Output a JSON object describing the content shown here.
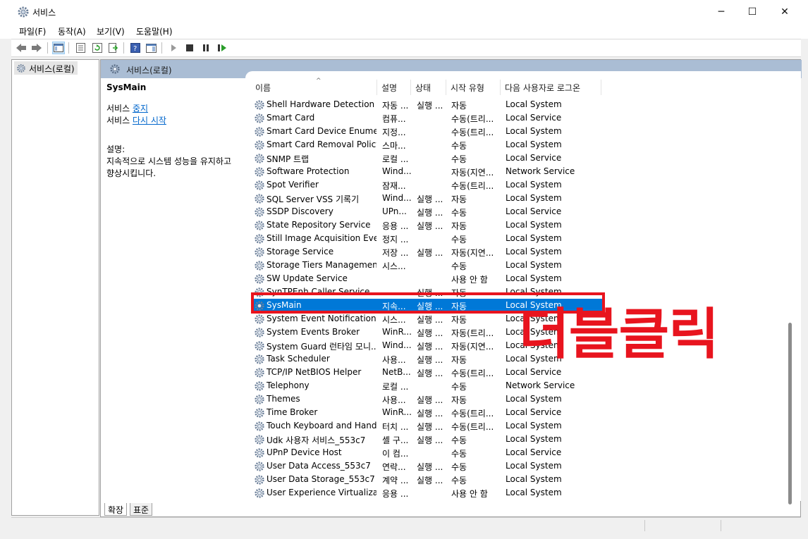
{
  "window": {
    "title": "서비스",
    "min": "─",
    "max": "☐",
    "close": "✕"
  },
  "menu": [
    "파일(F)",
    "동작(A)",
    "보기(V)",
    "도움말(H)"
  ],
  "tree": {
    "root": "서비스(로컬)"
  },
  "panel": {
    "title": "서비스(로컬)"
  },
  "description": {
    "service_name": "SysMain",
    "stop_prefix": "서비스 ",
    "stop_link": "중지",
    "restart_prefix": "서비스 ",
    "restart_link": "다시 시작",
    "desc_label": "설명:",
    "desc_text_1": "지속적으로 시스템 성능을 유지하고",
    "desc_text_2": "향상시킵니다."
  },
  "columns": [
    "이름",
    "설명",
    "상태",
    "시작 유형",
    "다음 사용자로 로그온"
  ],
  "services": [
    {
      "name": "Shell Hardware Detection",
      "desc": "자동 ...",
      "status": "실행 ...",
      "startup": "자동",
      "logon": "Local System"
    },
    {
      "name": "Smart Card",
      "desc": "컴퓨...",
      "status": "",
      "startup": "수동(트리...",
      "logon": "Local Service"
    },
    {
      "name": "Smart Card Device Enumer...",
      "desc": "지정...",
      "status": "",
      "startup": "수동(트리...",
      "logon": "Local System"
    },
    {
      "name": "Smart Card Removal Policy",
      "desc": "스마...",
      "status": "",
      "startup": "수동",
      "logon": "Local System"
    },
    {
      "name": "SNMP 트랩",
      "desc": "로컬 ...",
      "status": "",
      "startup": "수동",
      "logon": "Local Service"
    },
    {
      "name": "Software Protection",
      "desc": "Wind...",
      "status": "",
      "startup": "자동(지연...",
      "logon": "Network Service"
    },
    {
      "name": "Spot Verifier",
      "desc": "잠재...",
      "status": "",
      "startup": "수동(트리...",
      "logon": "Local System"
    },
    {
      "name": "SQL Server VSS 기록기",
      "desc": "Wind...",
      "status": "실행 ...",
      "startup": "자동",
      "logon": "Local System"
    },
    {
      "name": "SSDP Discovery",
      "desc": "UPn...",
      "status": "실행 ...",
      "startup": "수동",
      "logon": "Local Service"
    },
    {
      "name": "State Repository Service",
      "desc": "응용 ...",
      "status": "실행 ...",
      "startup": "자동",
      "logon": "Local System"
    },
    {
      "name": "Still Image Acquisition Eve...",
      "desc": "정지 ...",
      "status": "",
      "startup": "수동",
      "logon": "Local System"
    },
    {
      "name": "Storage Service",
      "desc": "저장 ...",
      "status": "실행 ...",
      "startup": "자동(지연...",
      "logon": "Local System"
    },
    {
      "name": "Storage Tiers Management",
      "desc": "시스...",
      "status": "",
      "startup": "수동",
      "logon": "Local System"
    },
    {
      "name": "SW Update Service",
      "desc": "",
      "status": "",
      "startup": "사용 안 함",
      "logon": "Local System"
    },
    {
      "name": "SynTPEnh Caller Service",
      "desc": "",
      "status": "실행 ...",
      "startup": "자동",
      "logon": "Local System"
    },
    {
      "name": "SysMain",
      "desc": "지속...",
      "status": "실행 ...",
      "startup": "자동",
      "logon": "Local System"
    },
    {
      "name": "System Event Notification ...",
      "desc": "시스...",
      "status": "실행 ...",
      "startup": "자동",
      "logon": "Local System"
    },
    {
      "name": "System Events Broker",
      "desc": "WinR...",
      "status": "실행 ...",
      "startup": "자동(트리...",
      "logon": "Local System"
    },
    {
      "name": "System Guard 런타임 모니...",
      "desc": "Wind...",
      "status": "실행 ...",
      "startup": "자동(지연...",
      "logon": "Local System"
    },
    {
      "name": "Task Scheduler",
      "desc": "사용...",
      "status": "실행 ...",
      "startup": "자동",
      "logon": "Local System"
    },
    {
      "name": "TCP/IP NetBIOS Helper",
      "desc": "NetB...",
      "status": "실행 ...",
      "startup": "수동(트리...",
      "logon": "Local Service"
    },
    {
      "name": "Telephony",
      "desc": "로컬 ...",
      "status": "",
      "startup": "수동",
      "logon": "Network Service"
    },
    {
      "name": "Themes",
      "desc": "사용...",
      "status": "실행 ...",
      "startup": "자동",
      "logon": "Local System"
    },
    {
      "name": "Time Broker",
      "desc": "WinR...",
      "status": "실행 ...",
      "startup": "수동(트리...",
      "logon": "Local Service"
    },
    {
      "name": "Touch Keyboard and Hand...",
      "desc": "터치 ...",
      "status": "실행 ...",
      "startup": "수동(트리...",
      "logon": "Local System"
    },
    {
      "name": "Udk 사용자 서비스_553c7",
      "desc": "셸 구...",
      "status": "실행 ...",
      "startup": "수동",
      "logon": "Local System"
    },
    {
      "name": "UPnP Device Host",
      "desc": "이 컴...",
      "status": "",
      "startup": "수동",
      "logon": "Local Service"
    },
    {
      "name": "User Data Access_553c7",
      "desc": "연락...",
      "status": "실행 ...",
      "startup": "수동",
      "logon": "Local System"
    },
    {
      "name": "User Data Storage_553c7",
      "desc": "계약 ...",
      "status": "실행 ...",
      "startup": "수동",
      "logon": "Local System"
    },
    {
      "name": "User Experience Virtualizati...",
      "desc": "응용 ...",
      "status": "",
      "startup": "사용 안 함",
      "logon": "Local System"
    }
  ],
  "selected_service": "SysMain",
  "annotation": "더블클릭",
  "tabs": [
    "확장",
    "표준"
  ],
  "colors": {
    "selection": "#0078d7",
    "annotation": "#e8141e",
    "panel_header": "#aabdd4",
    "link": "#0066cc"
  }
}
